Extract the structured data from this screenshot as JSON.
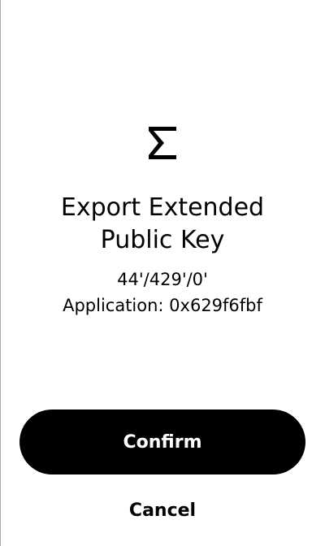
{
  "app": {
    "icon": "sigma-icon"
  },
  "screen": {
    "title_line1": "Export Extended",
    "title_line2": "Public Key",
    "path": "44'/429'/0'",
    "application": "Application: 0x629f6fbf"
  },
  "actions": {
    "confirm_label": "Confirm",
    "cancel_label": "Cancel"
  },
  "colors": {
    "primary": "#000000",
    "background": "#ffffff",
    "button_text": "#ffffff"
  }
}
